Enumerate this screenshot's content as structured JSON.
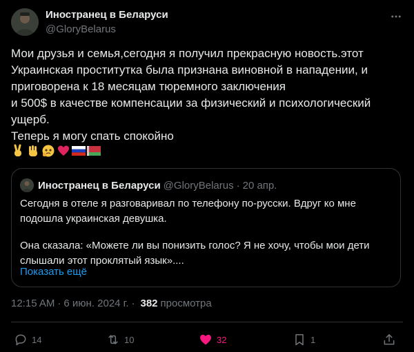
{
  "author": {
    "display_name": "Иностранец в Беларуси",
    "handle": "@GloryBelarus"
  },
  "post": {
    "text": "Мои друзья и семья,сегодня я получил прекрасную новость.этот\nУкраинская проститутка была признана виновной в нападении, и\nприговорена к 18 месяцам тюремного заключения\nи 500$ в качестве компенсации за физический и психологический\nущерб.\nТеперь я могу спать спокойно",
    "emojis": [
      "victory-hand",
      "raised-hand",
      "face-holding-back-tears",
      "red-heart",
      "flag-russia",
      "flag-belarus"
    ]
  },
  "quote": {
    "display_name": "Иностранец в Беларуси",
    "handle": "@GloryBelarus",
    "dot": "·",
    "date": "20 апр.",
    "text_1": "Сегодня в отеле я разговаривал по телефону по-русски. Вдруг ко мне подошла украинская девушка.",
    "text_2": "Она сказала: «Можете ли вы понизить голос? Я не хочу, чтобы мои дети слышали этот проклятый язык»....",
    "show_more": "Показать ещё"
  },
  "meta": {
    "time": "12:15 AM",
    "sep": "·",
    "date": "6 июн. 2024 г.",
    "views": "382",
    "views_label": "просмотра"
  },
  "actions": {
    "replies": "14",
    "reposts": "10",
    "likes": "32",
    "bookmarks": "1"
  },
  "colors": {
    "background": "#000000",
    "text": "#e7e9ea",
    "muted": "#71767b",
    "link": "#1d9bf0",
    "like": "#f91880",
    "border": "#2f3336"
  }
}
